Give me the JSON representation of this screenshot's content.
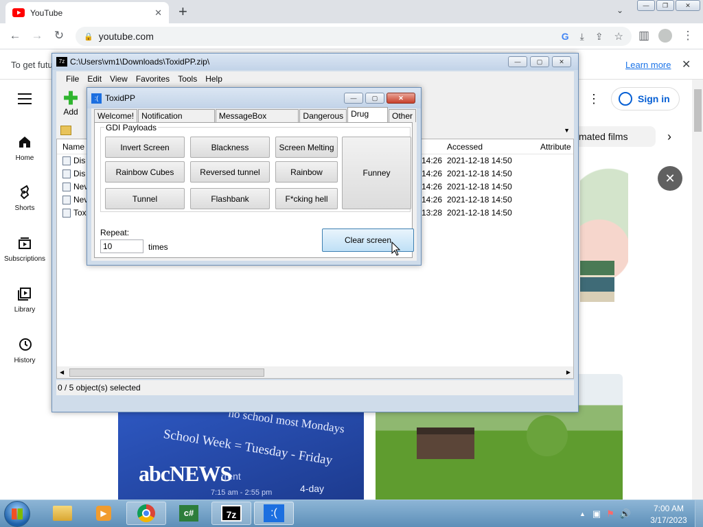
{
  "browser": {
    "tab_title": "YouTube",
    "new_tab": "+",
    "url": "youtube.com",
    "caption_min": "—",
    "caption_max": "❐",
    "caption_close": "✕"
  },
  "infobar": {
    "text": "To get futu",
    "learn_more": "Learn more",
    "close": "✕"
  },
  "youtube": {
    "sign_in": "Sign in",
    "chip": "mated films",
    "nav": [
      {
        "label": "Home"
      },
      {
        "label": "Shorts"
      },
      {
        "label": "Subscriptions"
      },
      {
        "label": "Library"
      },
      {
        "label": "History"
      }
    ],
    "thumb_text_1": "no school most Mondays",
    "thumb_text_2": "School Week = Tuesday - Friday",
    "thumb_text_3": "abcNEWS",
    "thumb_text_4": "7:15 am - 2:55 pm",
    "thumb_text_5": "4-day",
    "thumb_text_6": "rrent"
  },
  "sevenzip": {
    "title": "C:\\Users\\vm1\\Downloads\\ToxidPP.zip\\",
    "menu": [
      "File",
      "Edit",
      "View",
      "Favorites",
      "Tools",
      "Help"
    ],
    "add_label": "Add",
    "columns": {
      "name": "Name",
      "accessed": "Accessed",
      "attributes": "Attribute"
    },
    "rows": [
      {
        "name": "Dis",
        "modified": "14:26",
        "accessed": "2021-12-18 14:50"
      },
      {
        "name": "Dis",
        "modified": "14:26",
        "accessed": "2021-12-18 14:50"
      },
      {
        "name": "Nev",
        "modified": "14:26",
        "accessed": "2021-12-18 14:50"
      },
      {
        "name": "Nev",
        "modified": "14:26",
        "accessed": "2021-12-18 14:50"
      },
      {
        "name": "Tox",
        "modified": "13:28",
        "accessed": "2021-12-18 14:50"
      }
    ],
    "status": "0 / 5 object(s) selected"
  },
  "toxid": {
    "title": "ToxidPP",
    "tabs": [
      "Welcome!",
      "Notification Creator",
      "MessageBox Creator",
      "Dangerous",
      "Drug Trip",
      "Other"
    ],
    "active_tab": "Drug Trip",
    "group_label": "GDI Payloads",
    "buttons": [
      [
        "Invert Screen",
        "Blackness",
        "Screen Melting"
      ],
      [
        "Rainbow Cubes",
        "Reversed tunnel",
        "Rainbow"
      ],
      [
        "Tunnel",
        "Flashbank",
        "F*cking hell"
      ]
    ],
    "funney": "Funney",
    "repeat_label": "Repeat:",
    "repeat_value": "10",
    "times": "times",
    "clear_screen": "Clear screen"
  },
  "taskbar": {
    "time": "7:00 AM",
    "date": "3/17/2023",
    "app_csharp": "c#",
    "app_7z": "7z",
    "app_toxid": ":("
  }
}
